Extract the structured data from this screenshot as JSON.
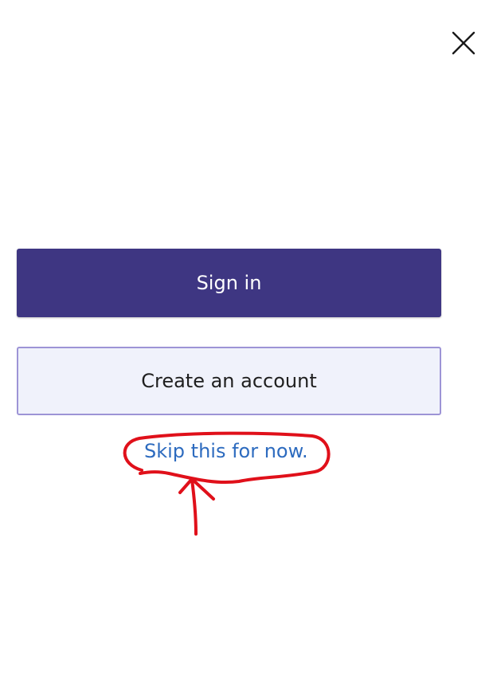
{
  "dialog": {
    "close_icon": "close-icon",
    "sign_in_label": "Sign in",
    "create_account_label": "Create an account",
    "skip_label": "Skip this for now."
  },
  "colors": {
    "primary_button": "#3e3682",
    "secondary_button_bg": "#f0f2fb",
    "secondary_button_border": "#9d94d6",
    "link": "#2d6bbf",
    "annotation": "#e0101a"
  }
}
